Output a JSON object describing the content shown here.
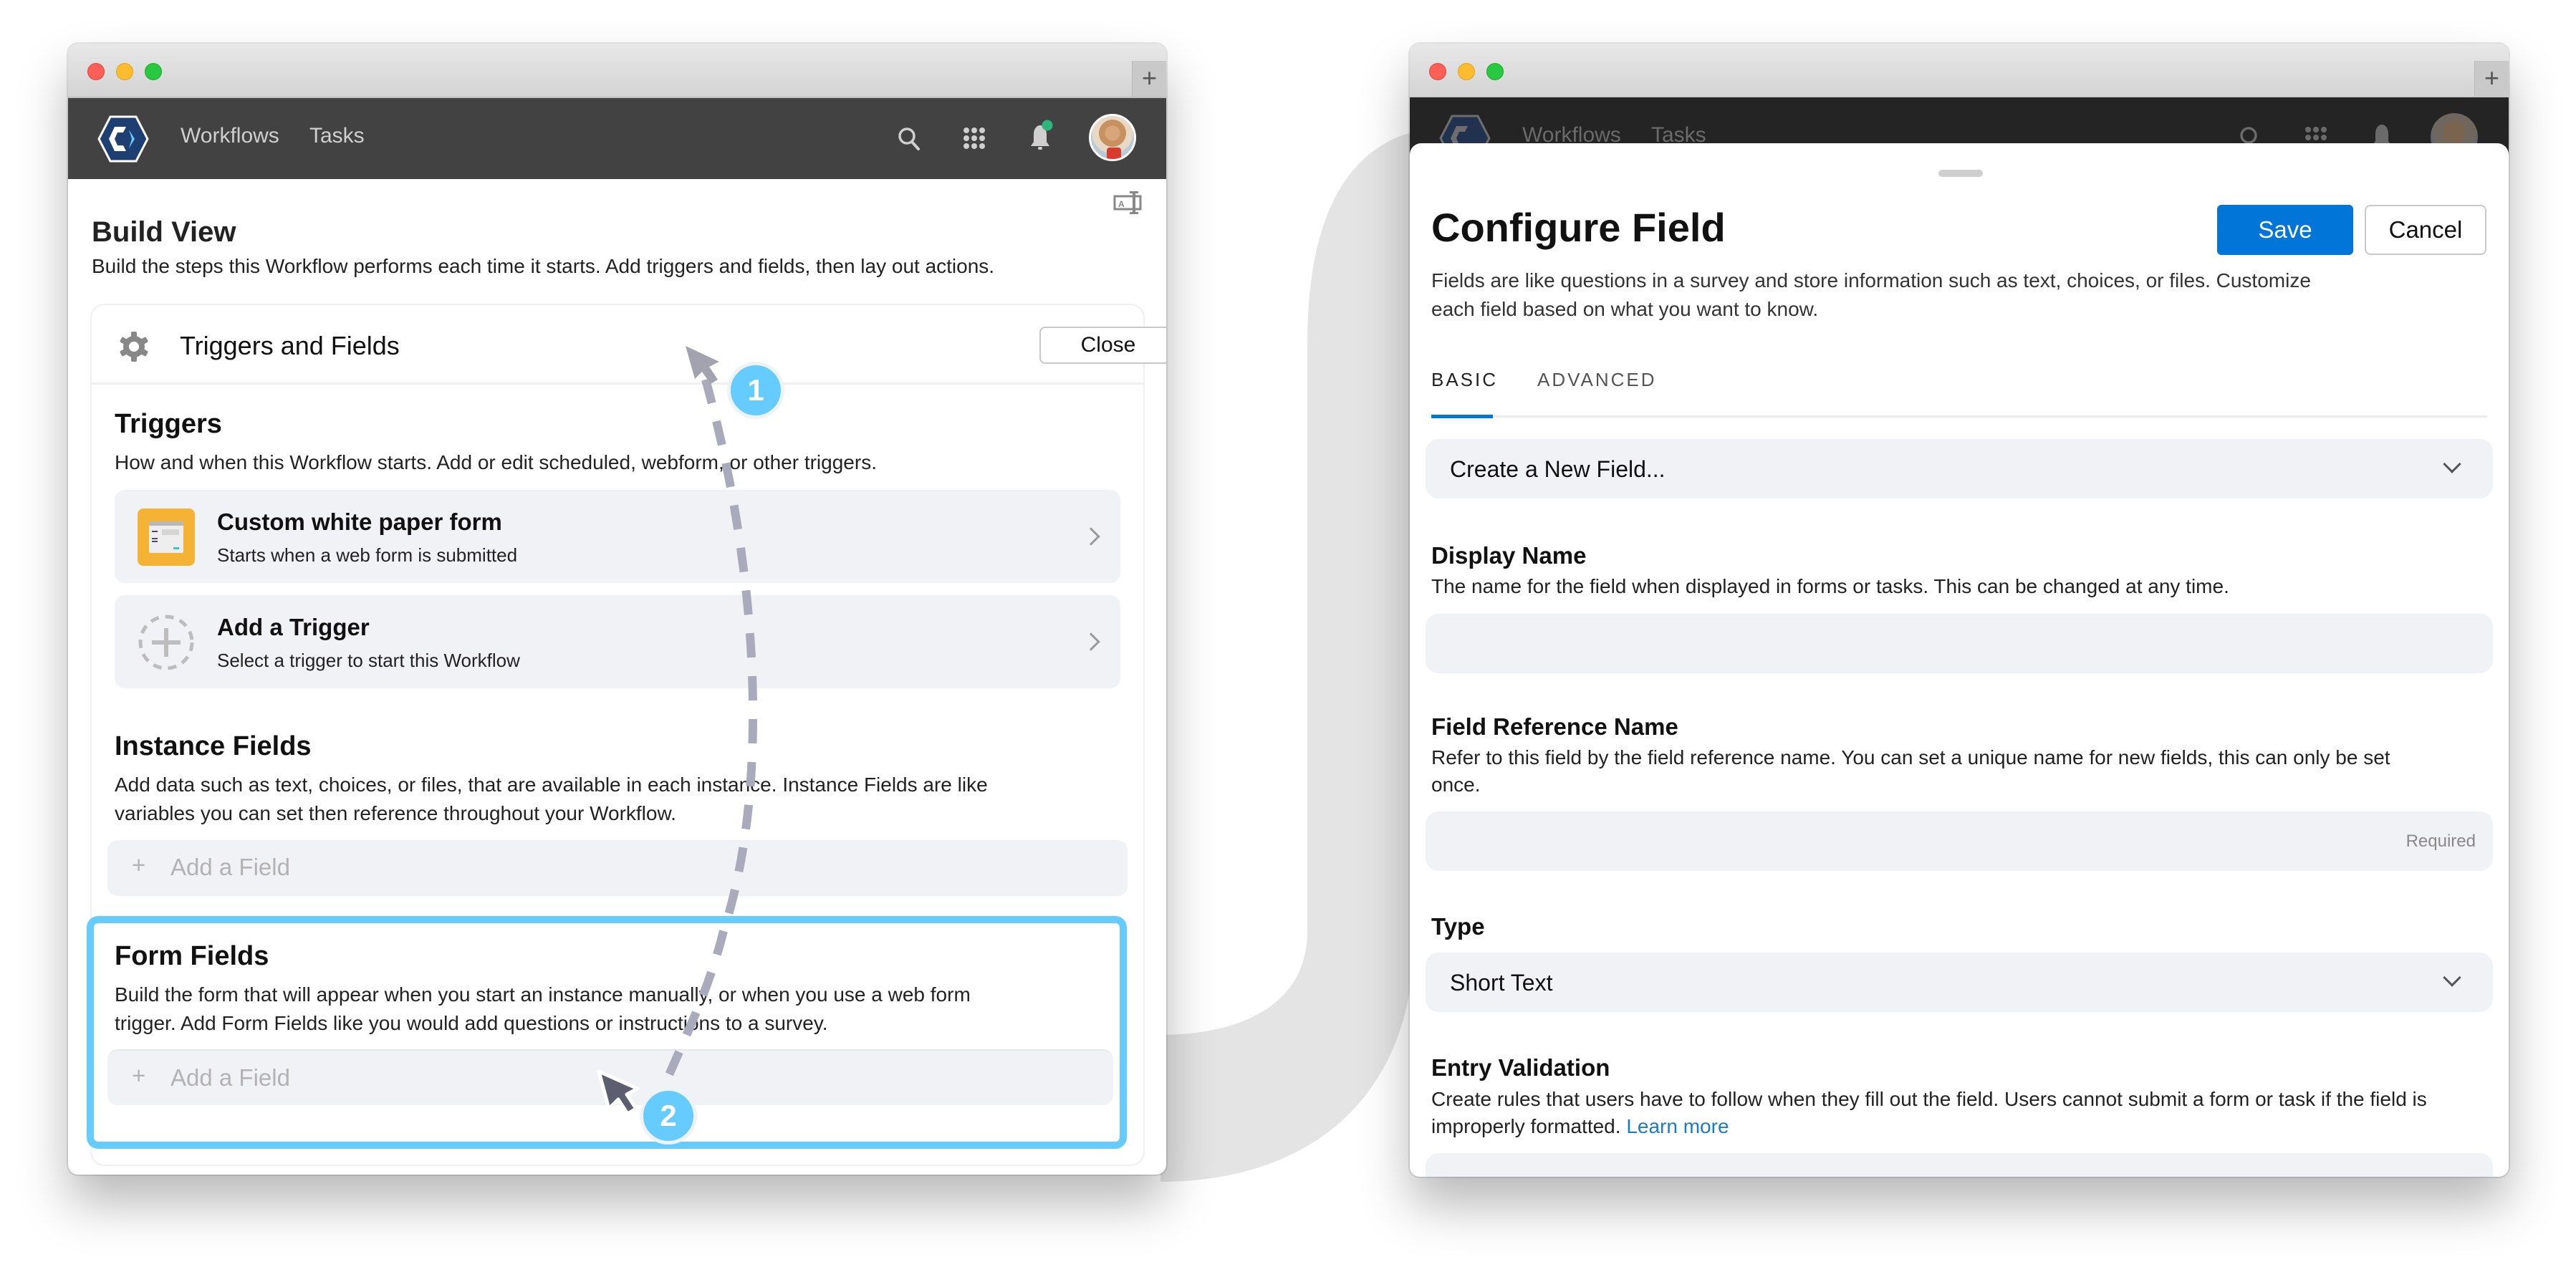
{
  "colors": {
    "highlight": "#66ccff",
    "primary": "#0275d8",
    "link": "#1a7cc4",
    "nav_bg": "#424242",
    "nav_bg_dimmed": "#242424",
    "row_bg": "#f1f2f6",
    "trigger_icon_bg": "#f5b335",
    "notification_dot": "#2db57a"
  },
  "left_window": {
    "new_tab_label": "+",
    "nav": {
      "logo": "app-logo",
      "links": [
        "Workflows",
        "Tasks"
      ],
      "icons": [
        "search-icon",
        "apps-grid-icon",
        "bell-icon",
        "avatar"
      ]
    },
    "page": {
      "title": "Build View",
      "description": "Build the steps this Workflow performs each time it starts. Add triggers and fields, then lay out actions.",
      "layout_icon": "text-field-icon"
    },
    "panel": {
      "title": "Triggers and Fields",
      "close_label": "Close",
      "triggers": {
        "heading": "Triggers",
        "description": "How and when this Workflow starts. Add or edit scheduled, webform, or other triggers.",
        "items": [
          {
            "title": "Custom white paper form",
            "subtitle": "Starts when a web form is submitted",
            "icon": "web-form-icon"
          },
          {
            "title": "Add a Trigger",
            "subtitle": "Select a trigger to start this Workflow",
            "icon": "add-trigger-icon"
          }
        ]
      },
      "instance_fields": {
        "heading": "Instance Fields",
        "description_line1": "Add data such as text, choices, or files, that are available in each instance. Instance Fields are like",
        "description_line2": "variables you can set then reference throughout your Workflow.",
        "add_label": "Add a Field"
      },
      "form_fields": {
        "heading": "Form Fields",
        "description_line1": "Build the form that will appear when you start an instance manually, or when you use a web form",
        "description_line2": "trigger. Add Form Fields like you would add questions or instructions to a survey.",
        "add_label": "Add a Field"
      }
    }
  },
  "annotations": {
    "step1": "1",
    "step2": "2"
  },
  "right_window": {
    "new_tab_label": "+",
    "nav": {
      "links": [
        "Workflows",
        "Tasks"
      ]
    },
    "sheet": {
      "title": "Configure Field",
      "save_label": "Save",
      "cancel_label": "Cancel",
      "description_line1": "Fields are like questions in a survey and store information such as text, choices, or files. Customize",
      "description_line2": "each field based on what you want to know.",
      "tabs": [
        {
          "label": "BASIC",
          "active": true
        },
        {
          "label": "ADVANCED",
          "active": false
        }
      ],
      "field_select": {
        "value": "Create a New Field..."
      },
      "display_name": {
        "label": "Display Name",
        "description": "The name for the field when displayed in forms or tasks. This can be changed at any time.",
        "value": ""
      },
      "field_reference_name": {
        "label": "Field Reference Name",
        "description_line1": "Refer to this field by the field reference name. You can set a unique name for new fields, this can only be set",
        "description_line2": "once.",
        "value": "",
        "hint": "Required"
      },
      "type": {
        "label": "Type",
        "value": "Short Text"
      },
      "entry_validation": {
        "label": "Entry Validation",
        "description_line1": "Create rules that users have to follow when they fill out the field. Users cannot submit a form or task if the field is",
        "description_line2": "improperly formatted.",
        "link": "Learn more"
      }
    }
  }
}
